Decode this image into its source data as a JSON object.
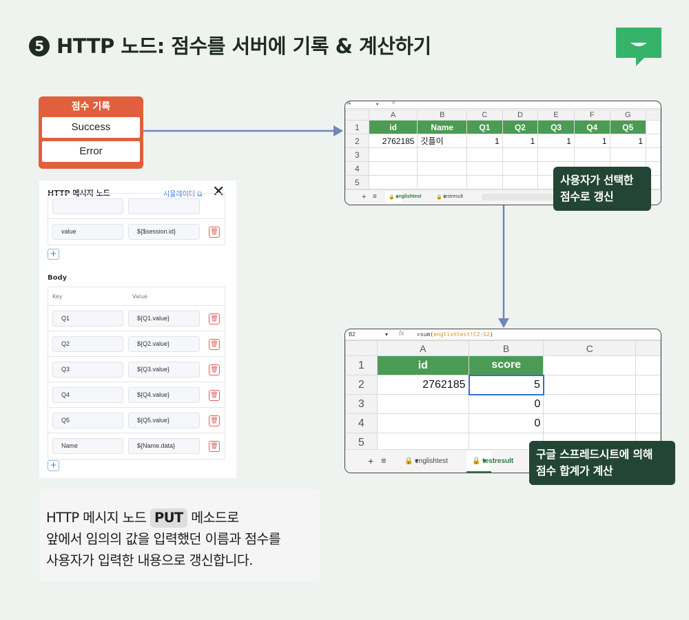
{
  "title": {
    "number": "5",
    "text": "HTTP 노드: 점수를 서버에 기록 & 계산하기"
  },
  "colors": {
    "background": "#eef3ef",
    "node_orange": "#e0603d",
    "sheet_header_green": "#4c9b55",
    "badge_dark_green": "#234536",
    "logo_green": "#35b36a",
    "arrow_blue": "#6f86bb"
  },
  "node": {
    "title": "점수 기록",
    "success_label": "Success",
    "error_label": "Error"
  },
  "http_panel": {
    "title": "HTTP 메시지 노드",
    "simulator_link": "시뮬레이터",
    "close_icon": "close-icon",
    "header_rows": [
      {
        "key": "value",
        "value": "${$session.id}"
      }
    ],
    "body_label": "Body",
    "body_columns": {
      "key": "Key",
      "value": "Value"
    },
    "body_rows": [
      {
        "key": "Q1",
        "value": "${Q1.value}"
      },
      {
        "key": "Q2",
        "value": "${Q2.value}"
      },
      {
        "key": "Q3",
        "value": "${Q3.value}"
      },
      {
        "key": "Q4",
        "value": "${Q4.value}"
      },
      {
        "key": "Q5",
        "value": "${Q5.value}"
      },
      {
        "key": "Name",
        "value": "${Name.data}"
      }
    ],
    "add_label": "+"
  },
  "sheet1": {
    "cell_ref": "I4",
    "fx": "fx",
    "columns": [
      "A",
      "B",
      "C",
      "D",
      "E",
      "F",
      "G"
    ],
    "row_numbers": [
      "1",
      "2",
      "3",
      "4",
      "5"
    ],
    "header": [
      "id",
      "Name",
      "Q1",
      "Q2",
      "Q3",
      "Q4",
      "Q5"
    ],
    "row2": [
      "2762185",
      "깃플이",
      "1",
      "1",
      "1",
      "1",
      "1"
    ],
    "tab_plus": "+",
    "tab1": "englishtest",
    "tab2": "testresult"
  },
  "sheet2": {
    "cell_ref": "B2",
    "fx": "fx",
    "formula_prefix": "=sum(",
    "formula_range": "englishtest!C2:G2",
    "formula_suffix": ")",
    "columns": [
      "A",
      "B",
      "C"
    ],
    "row_numbers": [
      "1",
      "2",
      "3",
      "4",
      "5"
    ],
    "header": [
      "id",
      "score"
    ],
    "row2": [
      "2762185",
      "5"
    ],
    "row3": [
      "",
      "0"
    ],
    "row4": [
      "",
      "0"
    ],
    "tab_plus": "+",
    "tab1": "englishtest",
    "tab2": "testresult"
  },
  "badge1": {
    "line1": "사용자가 선택한",
    "line2": "점수로 갱신"
  },
  "badge2": {
    "line1": "구글 스프레드시트에 의해",
    "line2": "점수 합계가 계산"
  },
  "caption": {
    "line1_a": "HTTP 메시지 노드 ",
    "line1_put": "PUT",
    "line1_b": " 메소드로",
    "line2": "앞에서 임의의 값을 입력했던 이름과 점수를",
    "line3": "사용자가 입력한 내용으로 갱신합니다."
  }
}
